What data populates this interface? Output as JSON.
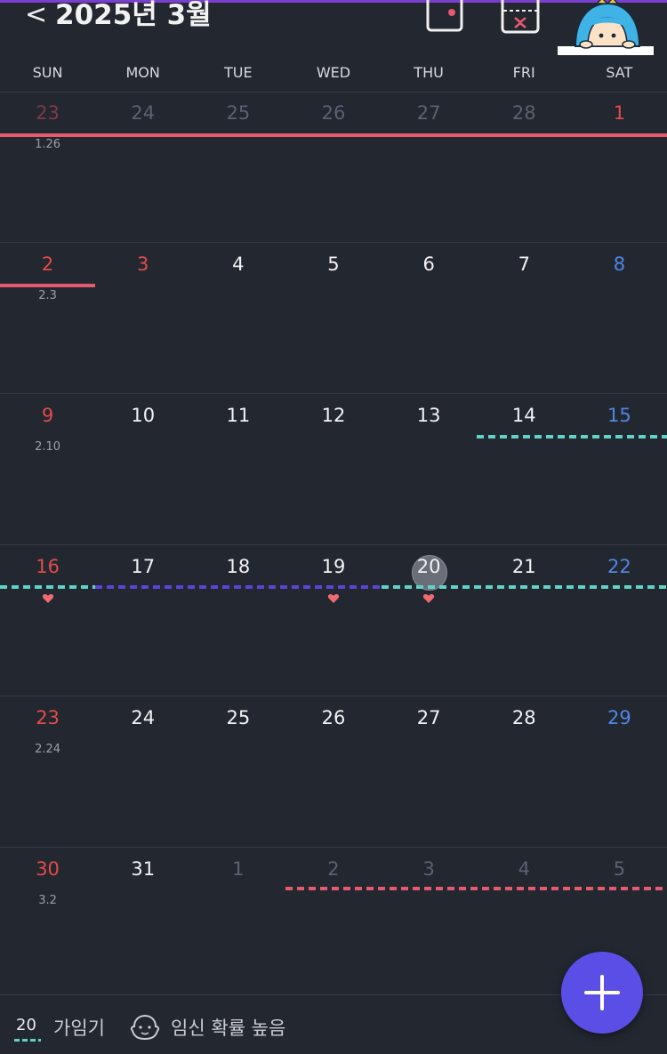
{
  "header": {
    "back_glyph": "<",
    "title": "2025년 3월"
  },
  "weekdays": [
    "SUN",
    "MON",
    "TUE",
    "WED",
    "THU",
    "FRI",
    "SAT"
  ],
  "weeks": [
    [
      {
        "day": "23",
        "lunar": "1.26",
        "style": "redmuted"
      },
      {
        "day": "24",
        "style": "muted"
      },
      {
        "day": "25",
        "style": "muted"
      },
      {
        "day": "26",
        "style": "muted"
      },
      {
        "day": "27",
        "style": "muted"
      },
      {
        "day": "28",
        "style": "muted"
      },
      {
        "day": "1",
        "style": "red"
      }
    ],
    [
      {
        "day": "2",
        "lunar": "2.3",
        "style": "red"
      },
      {
        "day": "3",
        "style": "red"
      },
      {
        "day": "4",
        "style": "white"
      },
      {
        "day": "5",
        "style": "white"
      },
      {
        "day": "6",
        "style": "white"
      },
      {
        "day": "7",
        "style": "white"
      },
      {
        "day": "8",
        "style": "blue"
      }
    ],
    [
      {
        "day": "9",
        "lunar": "2.10",
        "style": "red"
      },
      {
        "day": "10",
        "style": "white"
      },
      {
        "day": "11",
        "style": "white"
      },
      {
        "day": "12",
        "style": "white"
      },
      {
        "day": "13",
        "style": "white"
      },
      {
        "day": "14",
        "style": "white"
      },
      {
        "day": "15",
        "style": "blue"
      }
    ],
    [
      {
        "day": "16",
        "style": "red",
        "heart": true
      },
      {
        "day": "17",
        "style": "white"
      },
      {
        "day": "18",
        "style": "white"
      },
      {
        "day": "19",
        "style": "white",
        "heart": true
      },
      {
        "day": "20",
        "style": "white",
        "heart": true,
        "today": true
      },
      {
        "day": "21",
        "style": "white"
      },
      {
        "day": "22",
        "style": "blue"
      }
    ],
    [
      {
        "day": "23",
        "lunar": "2.24",
        "style": "red"
      },
      {
        "day": "24",
        "style": "white"
      },
      {
        "day": "25",
        "style": "white"
      },
      {
        "day": "26",
        "style": "white"
      },
      {
        "day": "27",
        "style": "white"
      },
      {
        "day": "28",
        "style": "white"
      },
      {
        "day": "29",
        "style": "blue"
      }
    ],
    [
      {
        "day": "30",
        "lunar": "3.2",
        "style": "red"
      },
      {
        "day": "31",
        "style": "white"
      },
      {
        "day": "1",
        "style": "muted"
      },
      {
        "day": "2",
        "style": "muted"
      },
      {
        "day": "3",
        "style": "muted"
      },
      {
        "day": "4",
        "style": "muted"
      },
      {
        "day": "5",
        "style": "muted"
      }
    ]
  ],
  "legend": {
    "number": "20",
    "label1": "가임기",
    "label2": "임신 확률 높음",
    "icon": "baby-face-icon"
  },
  "fab": {
    "icon": "plus-icon"
  },
  "colors": {
    "background": "#232730",
    "period": "#e55a6e",
    "fertile": "#5fd3c5",
    "ovulation": "#5a44d6",
    "accent": "#5b4ee6",
    "sunday": "#e34b4b",
    "saturday": "#4f86e6"
  }
}
